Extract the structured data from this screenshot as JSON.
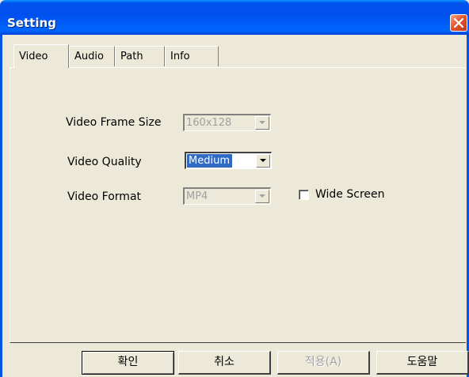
{
  "window": {
    "title": "Setting"
  },
  "tabs": [
    {
      "label": "Video",
      "active": true
    },
    {
      "label": "Audio",
      "active": false
    },
    {
      "label": "Path",
      "active": false
    },
    {
      "label": "Info",
      "active": false
    }
  ],
  "video": {
    "frame_size_label": "Video Frame Size",
    "frame_size_value": "160x128",
    "frame_size_enabled": false,
    "quality_label": "Video Quality",
    "quality_value": "Medium",
    "quality_enabled": true,
    "format_label": "Video Format",
    "format_value": "MP4",
    "format_enabled": false,
    "wide_screen_label": "Wide Screen",
    "wide_screen_checked": false
  },
  "buttons": {
    "ok": "확인",
    "cancel": "취소",
    "apply": "적용(A)",
    "help": "도움말"
  },
  "colors": {
    "title_bar": "#0053ee",
    "close_button": "#e2582f",
    "dialog_face": "#ece9d8",
    "selection": "#316ac5"
  },
  "icons": {
    "close": "close-icon",
    "dropdown": "chevron-down-icon"
  }
}
